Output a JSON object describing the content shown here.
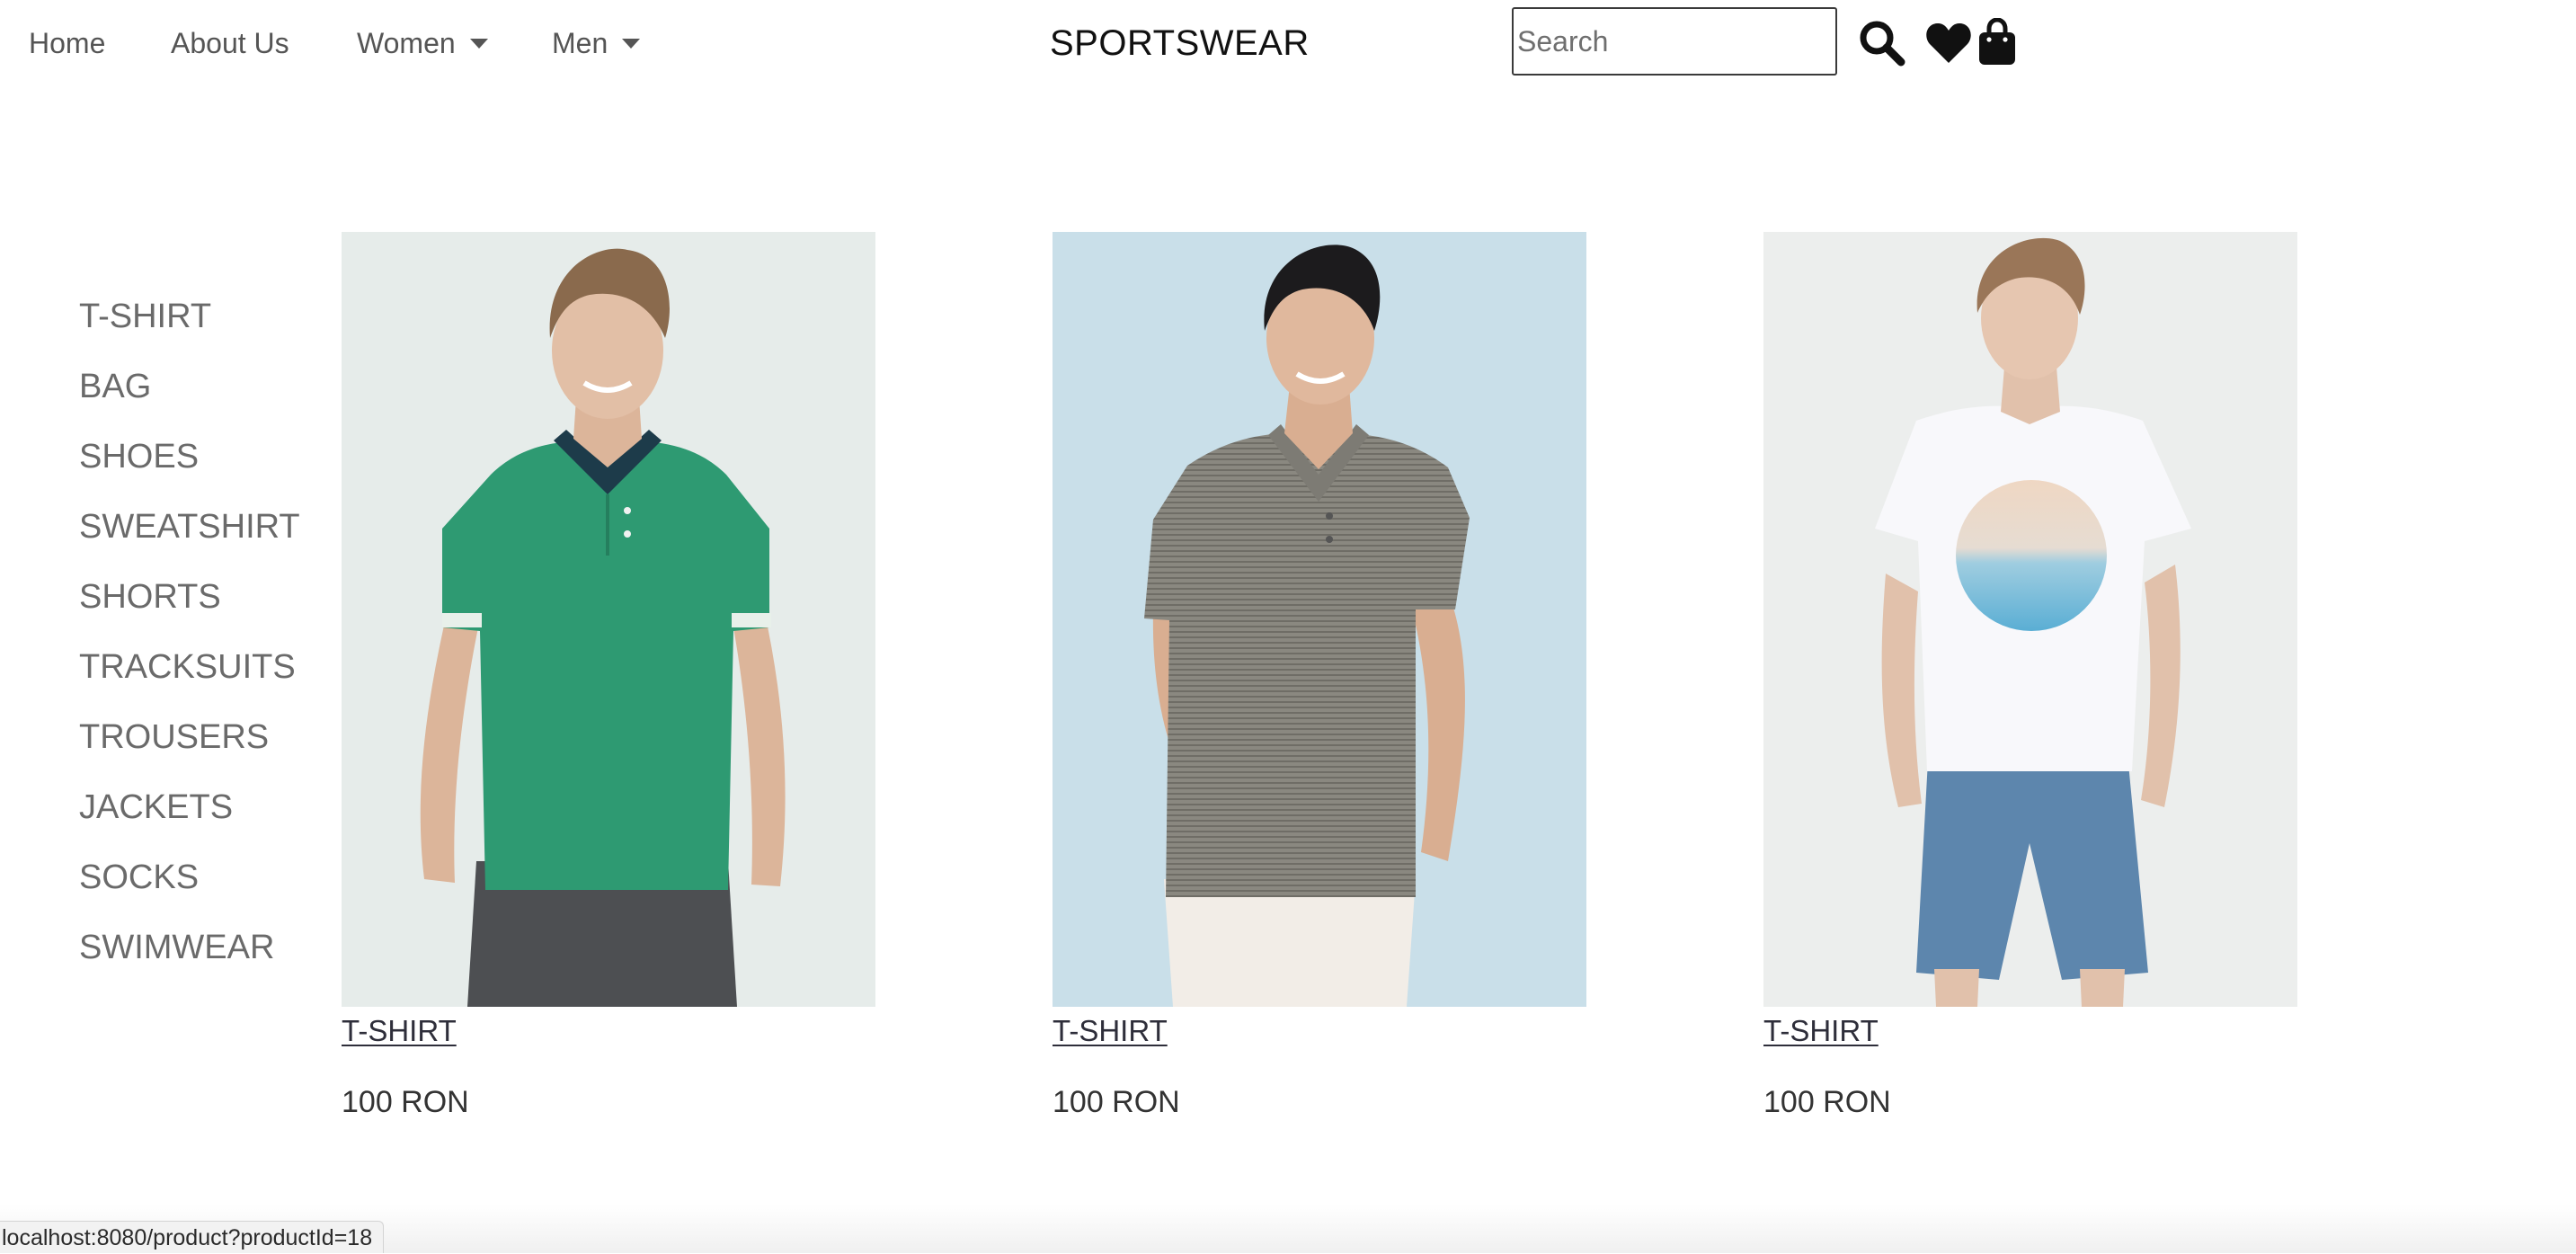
{
  "nav": {
    "home": "Home",
    "about": "About Us",
    "women": "Women",
    "men": "Men",
    "brand": "SPORTSWEAR",
    "search_placeholder": "Search"
  },
  "icons": {
    "search": "search-icon",
    "wishlist": "heart-icon",
    "cart": "shopping-bag-icon",
    "dropdown": "caret-down-icon"
  },
  "sidebar": {
    "items": [
      {
        "label": "T-SHIRT"
      },
      {
        "label": "BAG"
      },
      {
        "label": "SHOES"
      },
      {
        "label": "SWEATSHIRT"
      },
      {
        "label": "SHORTS"
      },
      {
        "label": "TRACKSUITS"
      },
      {
        "label": "TROUSERS"
      },
      {
        "label": "JACKETS"
      },
      {
        "label": "SOCKS"
      },
      {
        "label": "SWIMWEAR"
      }
    ]
  },
  "products": [
    {
      "name": "T-SHIRT",
      "price": "100 RON",
      "image": "model-green-polo-shirt"
    },
    {
      "name": "T-SHIRT",
      "price": "100 RON",
      "image": "model-grey-striped-polo-shirt"
    },
    {
      "name": "T-SHIRT",
      "price": "100 RON",
      "image": "model-white-graphic-tshirt"
    }
  ],
  "status_bar": {
    "url": "localhost:8080/product?productId=18"
  },
  "colors": {
    "nav_text": "#555555",
    "brand_text": "#111111",
    "sidebar_text": "#6a6a6a",
    "product_link": "#2e2e3a",
    "icon": "#111111",
    "product1_background": "#e6ecea",
    "product2_background": "#c9dfe9",
    "product3_background": "#eceeed"
  }
}
